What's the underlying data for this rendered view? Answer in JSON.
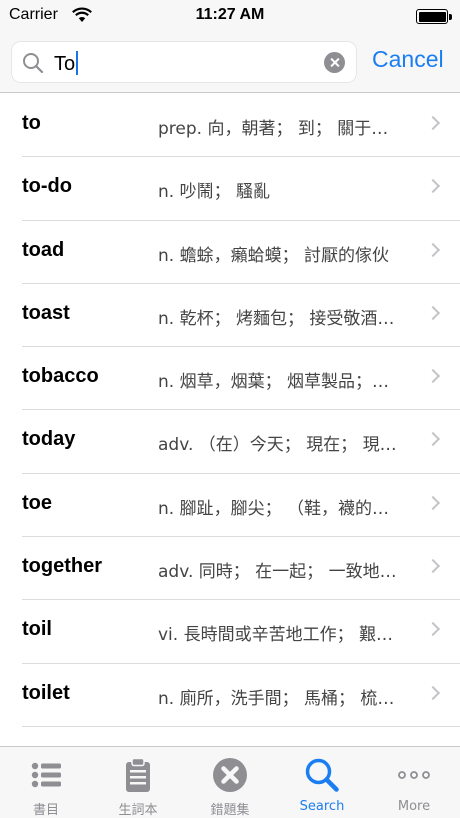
{
  "status_bar": {
    "carrier": "Carrier",
    "time": "11:27 AM"
  },
  "search": {
    "query": "To",
    "cancel_label": "Cancel"
  },
  "results": [
    {
      "word": "to",
      "definition": "prep. 向，朝著； 到； 關于…"
    },
    {
      "word": "to-do",
      "definition": "n. 吵鬧； 騷亂"
    },
    {
      "word": "toad",
      "definition": "n. 蟾蜍，癩蛤蟆； 討厭的傢伙"
    },
    {
      "word": "toast",
      "definition": "n. 乾杯； 烤麵包； 接受敬酒…"
    },
    {
      "word": "tobacco",
      "definition": "n. 烟草，烟葉； 烟草製品；…"
    },
    {
      "word": "today",
      "definition": "adv. （在）今天； 現在； 現…"
    },
    {
      "word": "toe",
      "definition": "n. 腳趾，腳尖； （鞋，襪的…"
    },
    {
      "word": "together",
      "definition": "adv. 同時； 在一起； 一致地…"
    },
    {
      "word": "toil",
      "definition": "vi. 長時間或辛苦地工作； 艱…"
    },
    {
      "word": "toilet",
      "definition": "n. 廁所，洗手間； 馬桶； 梳…"
    }
  ],
  "tabs": [
    {
      "label": "書目",
      "icon": "list-icon"
    },
    {
      "label": "生詞本",
      "icon": "clipboard-icon"
    },
    {
      "label": "錯題集",
      "icon": "x-circle-icon"
    },
    {
      "label": "Search",
      "icon": "search-icon"
    },
    {
      "label": "More",
      "icon": "more-icon"
    }
  ],
  "colors": {
    "accent": "#1a7ef2",
    "inactive": "#8e8e93"
  }
}
